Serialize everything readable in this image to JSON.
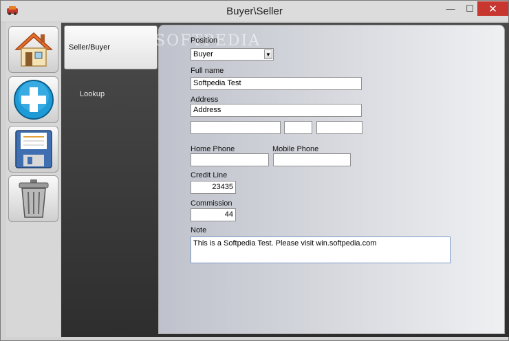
{
  "window": {
    "title": "Buyer\\Seller",
    "controls": {
      "minimize": "—",
      "maximize": "☐",
      "close": "✕"
    }
  },
  "toolbar": {
    "buttons": [
      {
        "icon": "home-icon"
      },
      {
        "icon": "add-icon"
      },
      {
        "icon": "save-icon"
      },
      {
        "icon": "trash-icon"
      }
    ]
  },
  "nav": {
    "items": [
      {
        "label": "Seller/Buyer",
        "active": true
      },
      {
        "label": "Lookup",
        "active": false
      }
    ]
  },
  "watermark": "SOFTPEDIA",
  "form": {
    "position_label": "Position",
    "position_value": "Buyer",
    "fullname_label": "Full name",
    "fullname_value": "Softpedia Test",
    "address_label": "Address",
    "address_line1": "Address",
    "address_line2": "",
    "address_city": "",
    "address_zip": "",
    "address_extra": "",
    "home_phone_label": "Home Phone",
    "home_phone_value": "",
    "mobile_phone_label": "Mobile Phone",
    "mobile_phone_value": "",
    "credit_line_label": "Credit Line",
    "credit_line_value": "23435",
    "commission_label": "Commission",
    "commission_value": "44",
    "note_label": "Note",
    "note_value": "This is a Softpedia Test. Please visit win.softpedia.com"
  },
  "colors": {
    "close_button": "#c7372f",
    "nav_dark": "#3a3a3a",
    "note_border": "#7a9ac7"
  }
}
